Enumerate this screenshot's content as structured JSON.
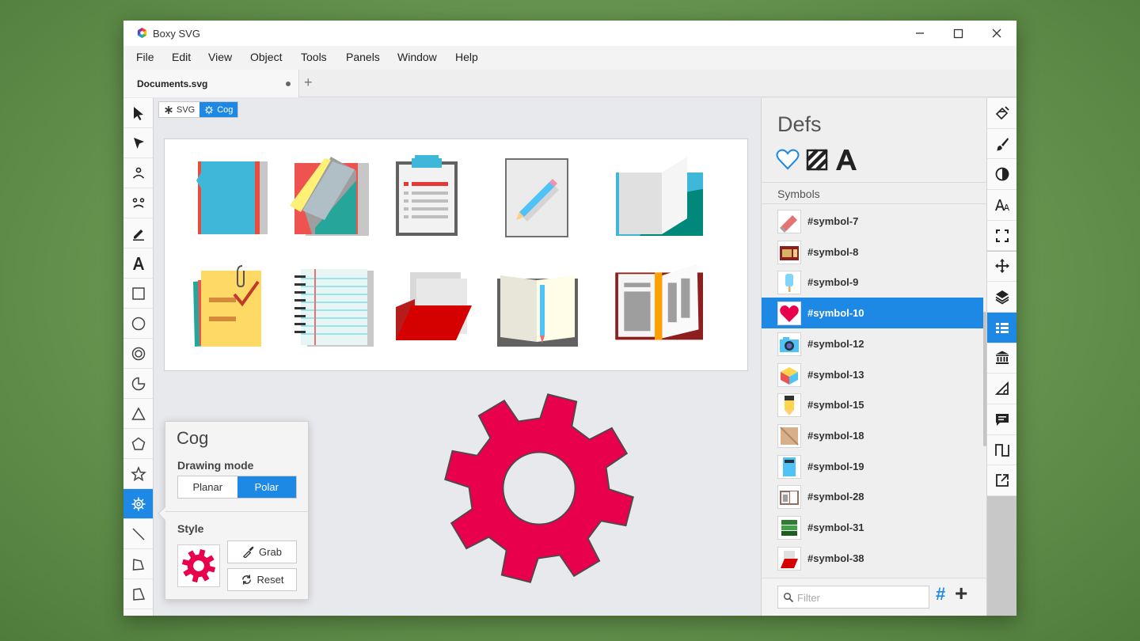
{
  "window": {
    "title": "Boxy SVG"
  },
  "menu": [
    "File",
    "Edit",
    "View",
    "Object",
    "Tools",
    "Panels",
    "Window",
    "Help"
  ],
  "tabs": {
    "document": "Documents.svg",
    "add": "+"
  },
  "breadcrumb": [
    "SVG",
    "Cog"
  ],
  "cog_popup": {
    "title": "Cog",
    "drawing_mode_label": "Drawing mode",
    "modes": [
      "Planar",
      "Polar"
    ],
    "selected_mode": "Polar",
    "style_label": "Style",
    "grab_label": "Grab",
    "reset_label": "Reset",
    "fill_color": "#e8004c"
  },
  "defs": {
    "title": "Defs",
    "section": "Symbols",
    "symbols": [
      "#symbol-7",
      "#symbol-8",
      "#symbol-9",
      "#symbol-10",
      "#symbol-12",
      "#symbol-13",
      "#symbol-15",
      "#symbol-18",
      "#symbol-19",
      "#symbol-28",
      "#symbol-31",
      "#symbol-38"
    ],
    "selected": "#symbol-10",
    "filter_placeholder": "Filter",
    "hash_label": "#",
    "add_label": "+"
  },
  "colors": {
    "accent": "#1e88e5",
    "cog": "#e8004c"
  },
  "left_tools": [
    "selection-arrow-icon",
    "node-arrow-icon",
    "person-icon",
    "faces-icon",
    "pencil-icon",
    "text-icon",
    "rectangle-icon",
    "ellipse-icon",
    "ring-icon",
    "pie-icon",
    "triangle-icon",
    "pentagon-icon",
    "star-icon",
    "cog-icon",
    "line-icon",
    "freeform-icon",
    "quad-icon"
  ],
  "right_tools": [
    "fill-bucket-icon",
    "brush-icon",
    "contrast-icon",
    "typography-icon",
    "fullscreen-icon",
    "move-icon",
    "layers-icon",
    "defs-list-icon",
    "library-icon",
    "angle-icon",
    "comment-icon",
    "waveform-icon",
    "export-icon"
  ]
}
